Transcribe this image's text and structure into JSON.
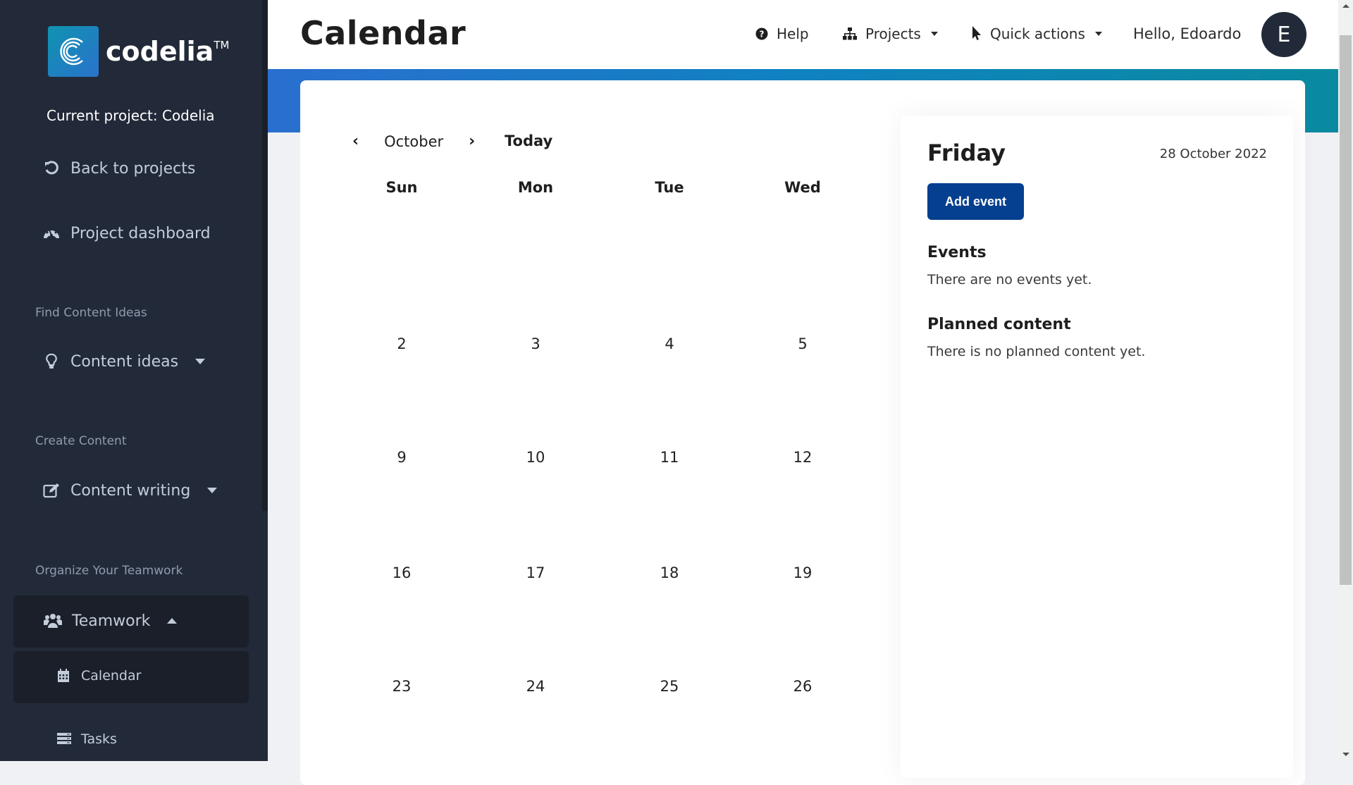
{
  "sidebar": {
    "logo_text": "codelia",
    "logo_tm": "TM",
    "current_project": "Current project: Codelia",
    "back_to_projects": "Back to projects",
    "project_dashboard": "Project dashboard",
    "sections": {
      "find": "Find Content Ideas",
      "create": "Create Content",
      "organize": "Organize Your Teamwork"
    },
    "content_ideas": "Content ideas",
    "content_writing": "Content writing",
    "teamwork": "Teamwork",
    "calendar": "Calendar",
    "tasks": "Tasks"
  },
  "header": {
    "title": "Calendar",
    "help": "Help",
    "projects": "Projects",
    "quick_actions": "Quick actions",
    "greeting": "Hello, Edoardo",
    "avatar_initial": "E"
  },
  "calendar": {
    "month": "October",
    "prev": "‹",
    "next": "›",
    "today": "Today",
    "weekdays": [
      "Sun",
      "Mon",
      "Tue",
      "Wed"
    ],
    "weeks": [
      [
        "2",
        "3",
        "4",
        "5"
      ],
      [
        "9",
        "10",
        "11",
        "12"
      ],
      [
        "16",
        "17",
        "18",
        "19"
      ],
      [
        "23",
        "24",
        "25",
        "26"
      ]
    ]
  },
  "panel": {
    "day": "Friday",
    "date": "28 October 2022",
    "add_event": "Add event",
    "events_heading": "Events",
    "events_empty": "There are no events yet.",
    "planned_heading": "Planned content",
    "planned_empty": "There is no planned content yet."
  },
  "colors": {
    "sidebar_bg": "#222a39",
    "accent_button": "#053f8f",
    "band_start": "#2a6fcf",
    "band_end": "#0a8aa0"
  }
}
